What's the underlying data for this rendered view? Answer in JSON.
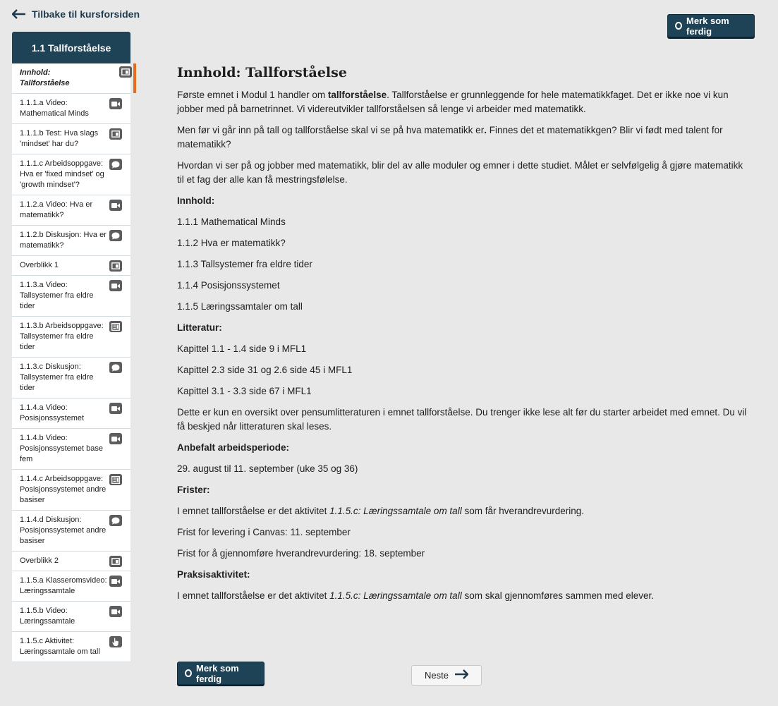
{
  "back_link": {
    "label": "Tilbake til kursforsiden"
  },
  "mark_done": {
    "label": "Merk som ferdig"
  },
  "sidebar": {
    "title": "1.1 Tallforståelse",
    "items": [
      {
        "label": "Innhold: Tallforståelse",
        "icon": "page-icon",
        "active": true
      },
      {
        "label": "1.1.1.a Video: Mathematical Minds",
        "icon": "video-icon"
      },
      {
        "label": "1.1.1.b Test: Hva slags 'mindset' har du?",
        "icon": "page-icon"
      },
      {
        "label": "1.1.1.c Arbeidsoppgave: Hva er 'fixed mindset' og 'growth mindset'?",
        "icon": "chat-icon"
      },
      {
        "label": "1.1.2.a Video: Hva er matematikk?",
        "icon": "video-icon"
      },
      {
        "label": "1.1.2.b Diskusjon: Hva er matematikk?",
        "icon": "chat-icon"
      },
      {
        "label": "Overblikk 1",
        "icon": "page-icon"
      },
      {
        "label": "1.1.3.a Video: Tallsystemer fra eldre tider",
        "icon": "video-icon"
      },
      {
        "label": "1.1.3.b Arbeidsoppgave: Tallsystemer fra eldre tider",
        "icon": "document-icon"
      },
      {
        "label": "1.1.3.c Diskusjon: Tallsystemer fra eldre tider",
        "icon": "chat-icon"
      },
      {
        "label": "1.1.4.a Video: Posisjonssystemet",
        "icon": "video-icon"
      },
      {
        "label": "1.1.4.b Video: Posisjonssystemet base fem",
        "icon": "video-icon"
      },
      {
        "label": "1.1.4.c Arbeidsoppgave: Posisjonssystemet andre basiser",
        "icon": "document-icon"
      },
      {
        "label": "1.1.4.d Diskusjon: Posisjonssystemet andre basiser",
        "icon": "chat-icon"
      },
      {
        "label": "Overblikk 2",
        "icon": "page-icon"
      },
      {
        "label": "1.1.5.a Klasseromsvideo: Læringssamtale",
        "icon": "video-icon"
      },
      {
        "label": "1.1.5.b Video: Læringssamtale",
        "icon": "video-icon"
      },
      {
        "label": "1.1.5.c Aktivitet: Læringssamtale om tall",
        "icon": "hand-icon"
      }
    ]
  },
  "content": {
    "title": "Innhold: Tallforståelse",
    "intro_1a": "Første emnet i Modul 1 handler om ",
    "intro_1b": "tallforståelse",
    "intro_1c": ". Tallforståelse er grunnleggende for hele matematikkfaget. Det er ikke noe vi kun jobber med på barnetrinnet. Vi videreutvikler tallforståelsen så lenge vi arbeider med matematikk.",
    "intro_2a": "Men før vi går inn på tall og tallforståelse skal vi se på hva matematikk er",
    "intro_2b": ".",
    "intro_2c": " Finnes det et matematikkgen? Blir vi født med talent for matematikk?",
    "intro_3": "Hvordan vi ser på og jobber med matematikk, blir del av alle moduler og emner i dette studiet. Målet er selvfølgelig å gjøre matematikk til et fag der alle kan få mestringsfølelse.",
    "innhold_heading": "Innhold:",
    "innhold_items": [
      "1.1.1 Mathematical Minds",
      "1.1.2 Hva er matematikk?",
      "1.1.3 Tallsystemer fra eldre tider",
      "1.1.4 Posisjonssystemet",
      "1.1.5 Læringssamtaler om tall"
    ],
    "litteratur_heading": "Litteratur:",
    "litteratur_items": [
      "Kapittel 1.1 - 1.4 side 9 i MFL1",
      "Kapittel 2.3 side 31 og 2.6 side 45 i MFL1",
      "Kapittel 3.1 - 3.3 side 67 i MFL1"
    ],
    "litteratur_note": "Dette er kun en oversikt over pensumlitteraturen i emnet tallforståelse. Du trenger ikke lese alt før du starter arbeidet med emnet. Du vil få beskjed når litteraturen skal leses.",
    "periode_heading": "Anbefalt arbeidsperiode:",
    "periode_text": "29. august til 11. september (uke 35 og 36)",
    "frister_heading": "Frister:",
    "frister_1a": "I emnet tallforståelse er det aktivitet ",
    "frister_1b": "1.1.5.c: Læringssamtale om tall",
    "frister_1c": " som får hverandrevurdering.",
    "frister_2": "Frist for levering i Canvas: 11. september",
    "frister_3": "Frist for å gjennomføre hverandrevurdering: 18. september",
    "praksis_heading": "Praksisaktivitet:",
    "praksis_1a": "I emnet tallforståelse er det aktivitet ",
    "praksis_1b": "1.1.5.c: Læringssamtale om tall",
    "praksis_1c": " som skal gjennomføres sammen med elever."
  },
  "next_button": {
    "label": "Neste"
  }
}
